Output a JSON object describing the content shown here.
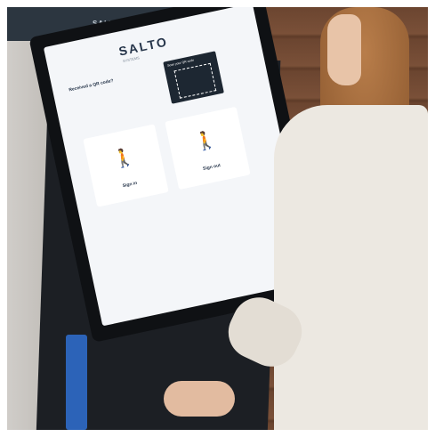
{
  "banner": {
    "brand": "SALTO"
  },
  "screen": {
    "logo": "SALTO",
    "logo_sub": "SYSTEMS",
    "qr_title": "Received a QR code?",
    "qr_box_label": "Scan your QR code",
    "sign_in": "Sign in",
    "sign_out": "Sign out"
  },
  "colors": {
    "accent": "#1f6fd1",
    "screen_bg": "#f4f6f9",
    "kiosk": "#0f1114"
  }
}
